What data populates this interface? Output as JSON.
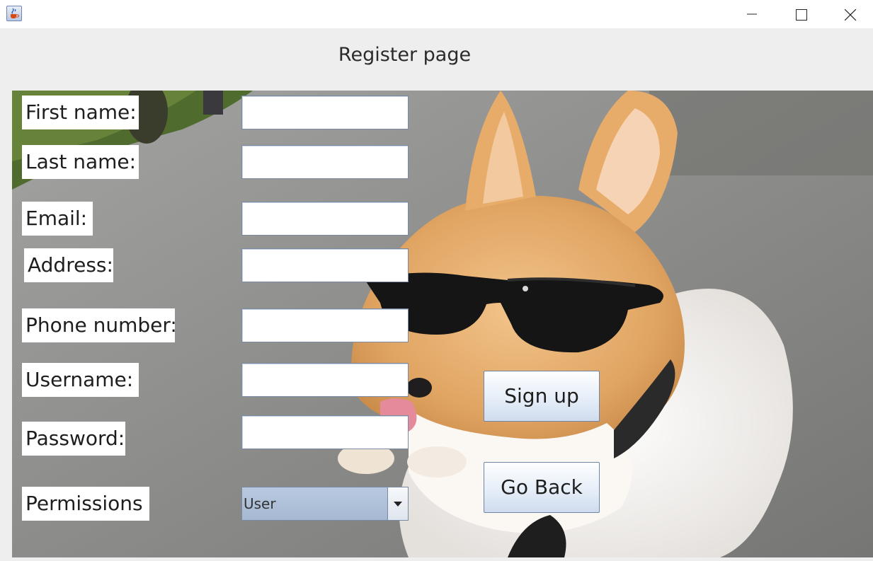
{
  "window": {
    "icon": "java-cup-icon",
    "controls": [
      "minimize-icon",
      "maximize-icon",
      "close-icon"
    ]
  },
  "page": {
    "title": "Register page"
  },
  "form": {
    "first_name_label": "First name:",
    "last_name_label": "Last name:",
    "email_label": "Email:",
    "address_label": "Address:",
    "phone_label": "Phone number:",
    "username_label": "Username:",
    "password_label": "Password:",
    "permissions_label": "Permissions",
    "first_name_value": "",
    "last_name_value": "",
    "email_value": "",
    "address_value": "",
    "phone_value": "",
    "username_value": "",
    "password_value": "",
    "permissions_selected": "User"
  },
  "actions": {
    "signup_label": "Sign up",
    "goback_label": "Go Back"
  },
  "colors": {
    "button_border": "#6f86a8",
    "combo_fill": "#a6b9d2",
    "window_bg": "#eeeeee"
  }
}
